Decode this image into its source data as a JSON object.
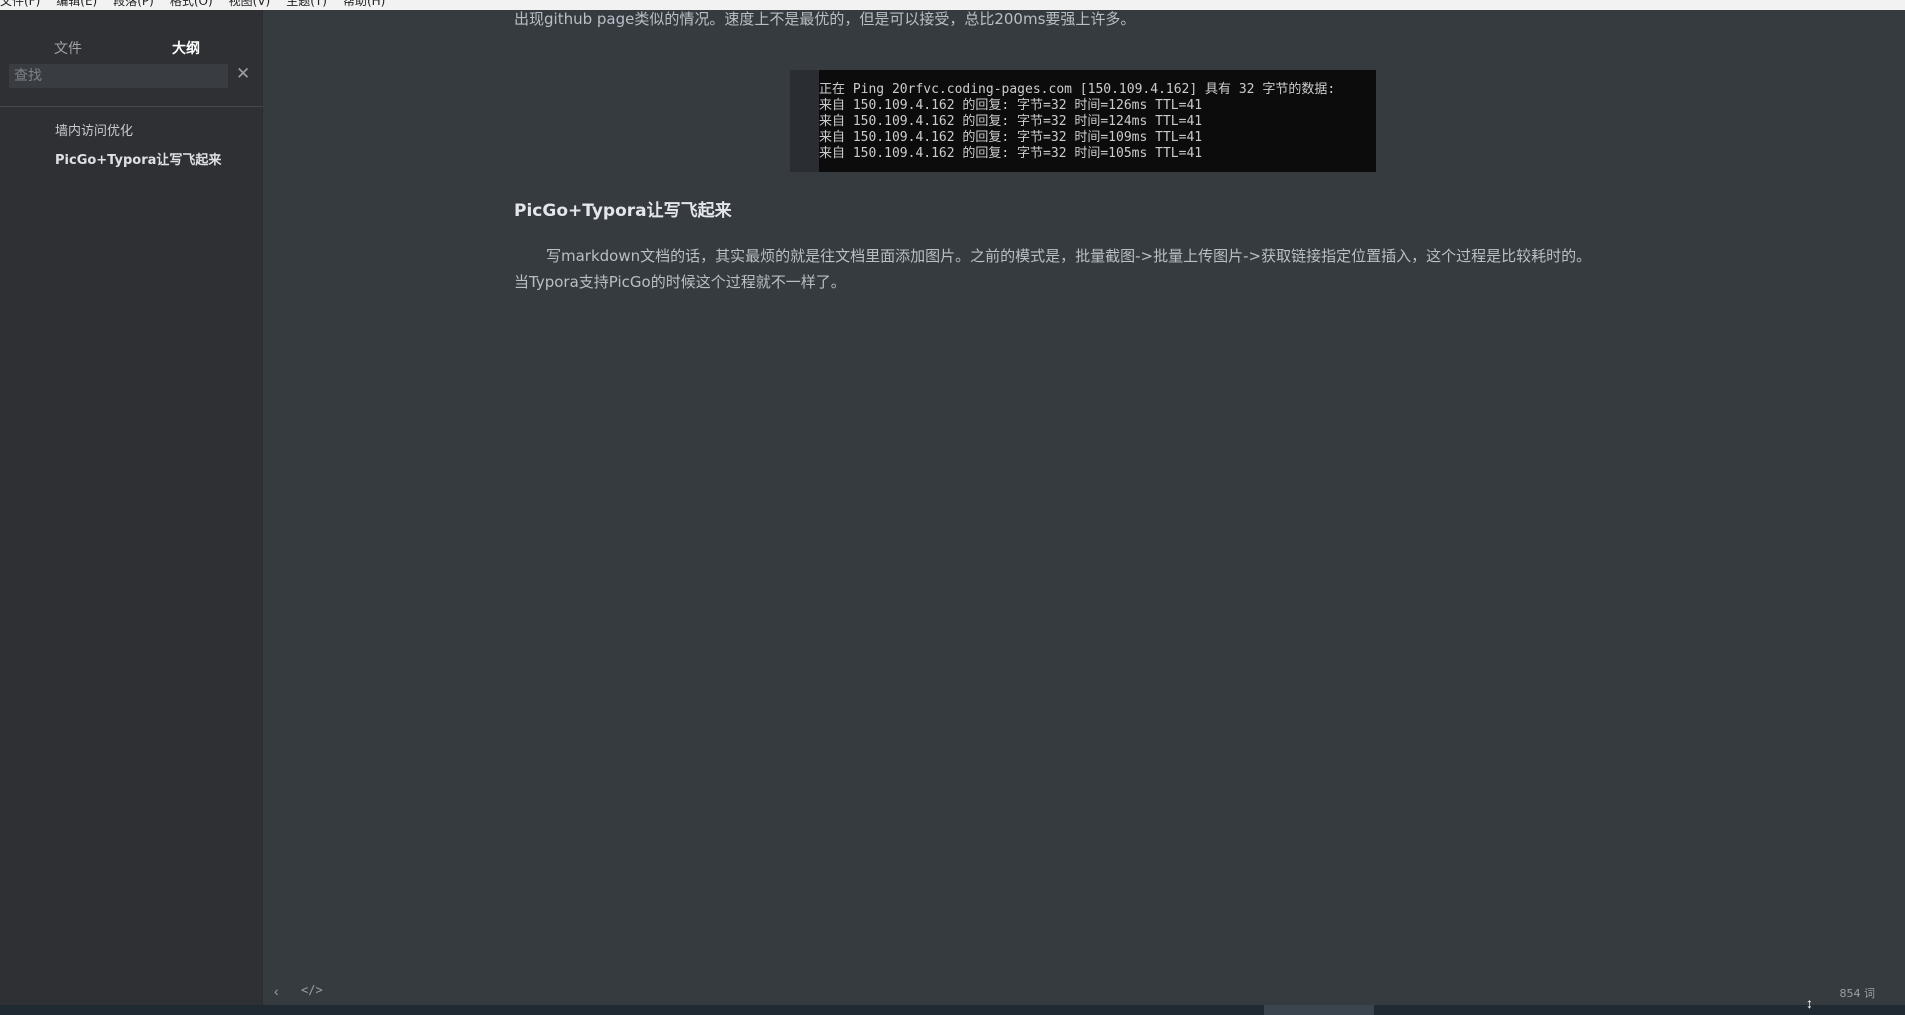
{
  "menubar": {
    "items": [
      "文件(F)",
      "编辑(E)",
      "段落(P)",
      "格式(O)",
      "视图(V)",
      "主题(T)",
      "帮助(H)"
    ]
  },
  "sidebar": {
    "tabs": {
      "files": "文件",
      "outline": "大纲"
    },
    "search_placeholder": "查找",
    "outline_items": [
      "墙内访问优化",
      "PicGo+Typora让写飞起来"
    ]
  },
  "editor": {
    "para_top_line": "出现github page类似的情况。速度上不是最优的，但是可以接受，总比200ms要强上许多。",
    "code_lines": [
      "正在 Ping 20rfvc.coding-pages.com [150.109.4.162] 具有 32 字节的数据:",
      "来自 150.109.4.162 的回复: 字节=32 时间=126ms TTL=41",
      "来自 150.109.4.162 的回复: 字节=32 时间=124ms TTL=41",
      "来自 150.109.4.162 的回复: 字节=32 时间=109ms TTL=41",
      "来自 150.109.4.162 的回复: 字节=32 时间=105ms TTL=41"
    ],
    "heading": "PicGo+Typora让写飞起来",
    "para_2_line_1": "写markdown文档的话，其实最烦的就是往文档里面添加图片。之前的模式是，批量截图->批量上传图片->获取链接指定位置插入，这个过程是比较耗时的。",
    "para_2_line_2": "当Typora支持PicGo的时候这个过程就不一样了。"
  },
  "statusbar": {
    "prev_icon": "chevron-left-icon",
    "source_icon": "code-icon",
    "word_count": "854 词"
  },
  "colors": {
    "editor_bg": "#363b40",
    "sidebar_bg": "#2e3033",
    "code_bg": "#0c0c0c"
  }
}
